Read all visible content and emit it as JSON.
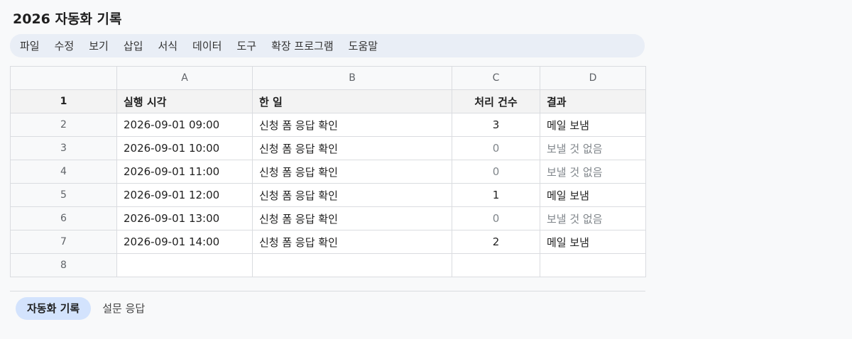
{
  "doc": {
    "title": "2026 자동화 기록"
  },
  "menu": [
    "파일",
    "수정",
    "보기",
    "삽입",
    "서식",
    "데이터",
    "도구",
    "확장 프로그램",
    "도움말"
  ],
  "columns": [
    "A",
    "B",
    "C",
    "D"
  ],
  "header_row": {
    "num": "1",
    "cells": [
      "실행 시각",
      "한 일",
      "처리 건수",
      "결과"
    ]
  },
  "rows": [
    {
      "num": "2",
      "cells": [
        "2026-09-01 09:00",
        "신청 폼 응답 확인",
        "3",
        "메일 보냄"
      ]
    },
    {
      "num": "3",
      "cells": [
        "2026-09-01 10:00",
        "신청 폼 응답 확인",
        "0",
        "보낼 것 없음"
      ]
    },
    {
      "num": "4",
      "cells": [
        "2026-09-01 11:00",
        "신청 폼 응답 확인",
        "0",
        "보낼 것 없음"
      ]
    },
    {
      "num": "5",
      "cells": [
        "2026-09-01 12:00",
        "신청 폼 응답 확인",
        "1",
        "메일 보냄"
      ]
    },
    {
      "num": "6",
      "cells": [
        "2026-09-01 13:00",
        "신청 폼 응답 확인",
        "0",
        "보낼 것 없음"
      ]
    },
    {
      "num": "7",
      "cells": [
        "2026-09-01 14:00",
        "신청 폼 응답 확인",
        "2",
        "메일 보냄"
      ]
    },
    {
      "num": "8",
      "cells": [
        "",
        "",
        "",
        ""
      ]
    }
  ],
  "sheets": [
    "자동화 기록",
    "설문 응답"
  ],
  "colors": {
    "menubar_bg": "#e9eef6",
    "active_tab_bg": "#d3e3fd",
    "muted_text": "#80868b"
  }
}
